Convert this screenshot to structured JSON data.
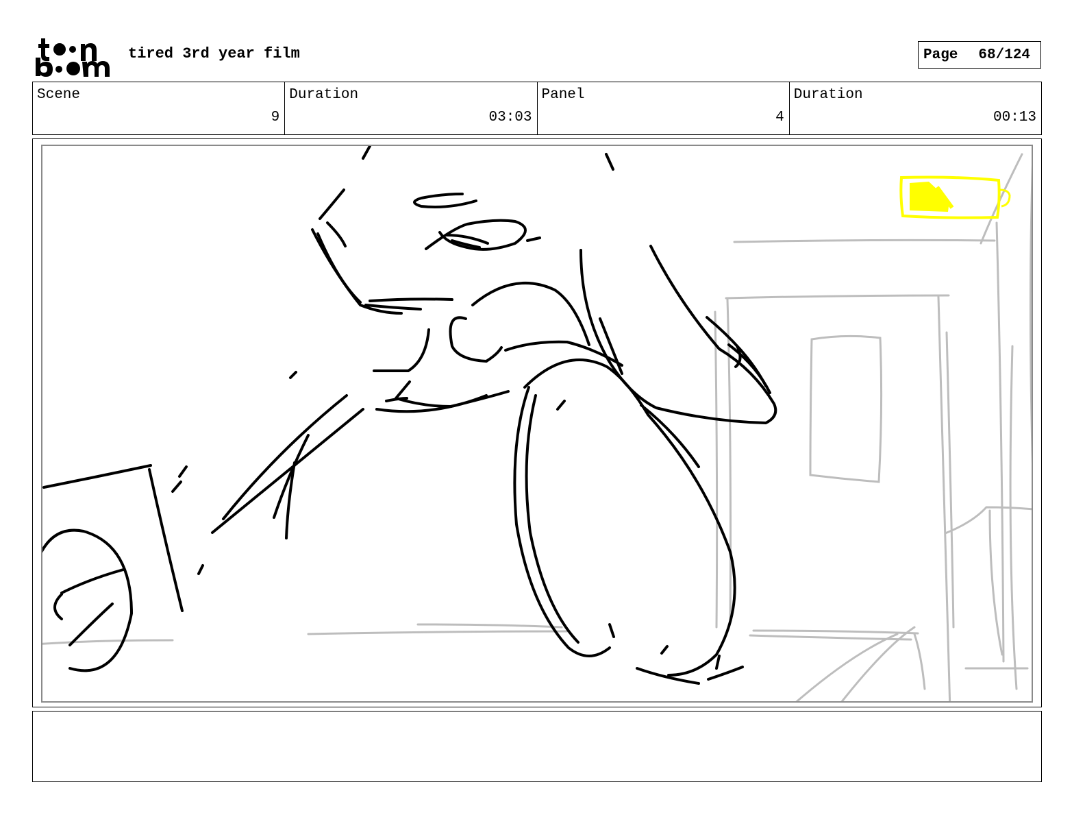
{
  "header": {
    "logo_text": "toon boom",
    "project_title": "tired 3rd year film",
    "page_label": "Page",
    "page_number": "68/124"
  },
  "info": {
    "scene_label": "Scene",
    "scene_value": "9",
    "scene_duration_label": "Duration",
    "scene_duration_value": "03:03",
    "panel_label": "Panel",
    "panel_value": "4",
    "panel_duration_label": "Duration",
    "panel_duration_value": "00:13"
  },
  "notes": {
    "text": ""
  },
  "colors": {
    "sketch_line": "#000000",
    "background_sketch": "#bdbdbd",
    "battery_highlight": "#ffff00"
  }
}
